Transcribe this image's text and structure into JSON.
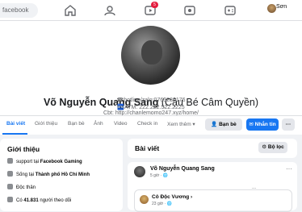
{
  "topbar": {
    "search_text": "facebook",
    "notification_count": "5",
    "user_name": "Sơn"
  },
  "profile": {
    "name": "Võ Nguyễn Quang Sang",
    "alias": "(Cậu Bé Câm Quyền)",
    "info_line1": "Cbt: http://chanlemomo247.xyz/home/",
    "info_line2": "☎hotline/zalo:0763286176",
    "info_line3": "🏧ATM: 222.222.522.2225"
  },
  "tabs": [
    {
      "label": "Bài viết"
    },
    {
      "label": "Giới thiệu"
    },
    {
      "label": "Bạn bè"
    },
    {
      "label": "Ảnh"
    },
    {
      "label": "Video"
    },
    {
      "label": "Check in"
    },
    {
      "label": "Xem thêm ▾"
    }
  ],
  "actions": {
    "friends": "Bạn bè",
    "message": "Nhắn tin",
    "more": "···"
  },
  "intro": {
    "title": "Giới thiệu",
    "rows": [
      {
        "prefix": "support tại ",
        "bold": "Facebook Gaming"
      },
      {
        "prefix": "Sống tại ",
        "bold": "Thành phố Hồ Chí Minh"
      },
      {
        "prefix": "Độc thân",
        "bold": ""
      },
      {
        "prefix": "Có ",
        "bold": "41.831",
        "suffix": " người theo dõi"
      }
    ]
  },
  "posts": {
    "title": "Bài viết",
    "filter": "Bộ lọc",
    "post_author": "Võ Nguyễn Quang Sang",
    "post_time": "5 giờ · 🌐",
    "shared_author": "Cô Độc Vương ›",
    "shared_time": "23 giờ · 🌐"
  }
}
